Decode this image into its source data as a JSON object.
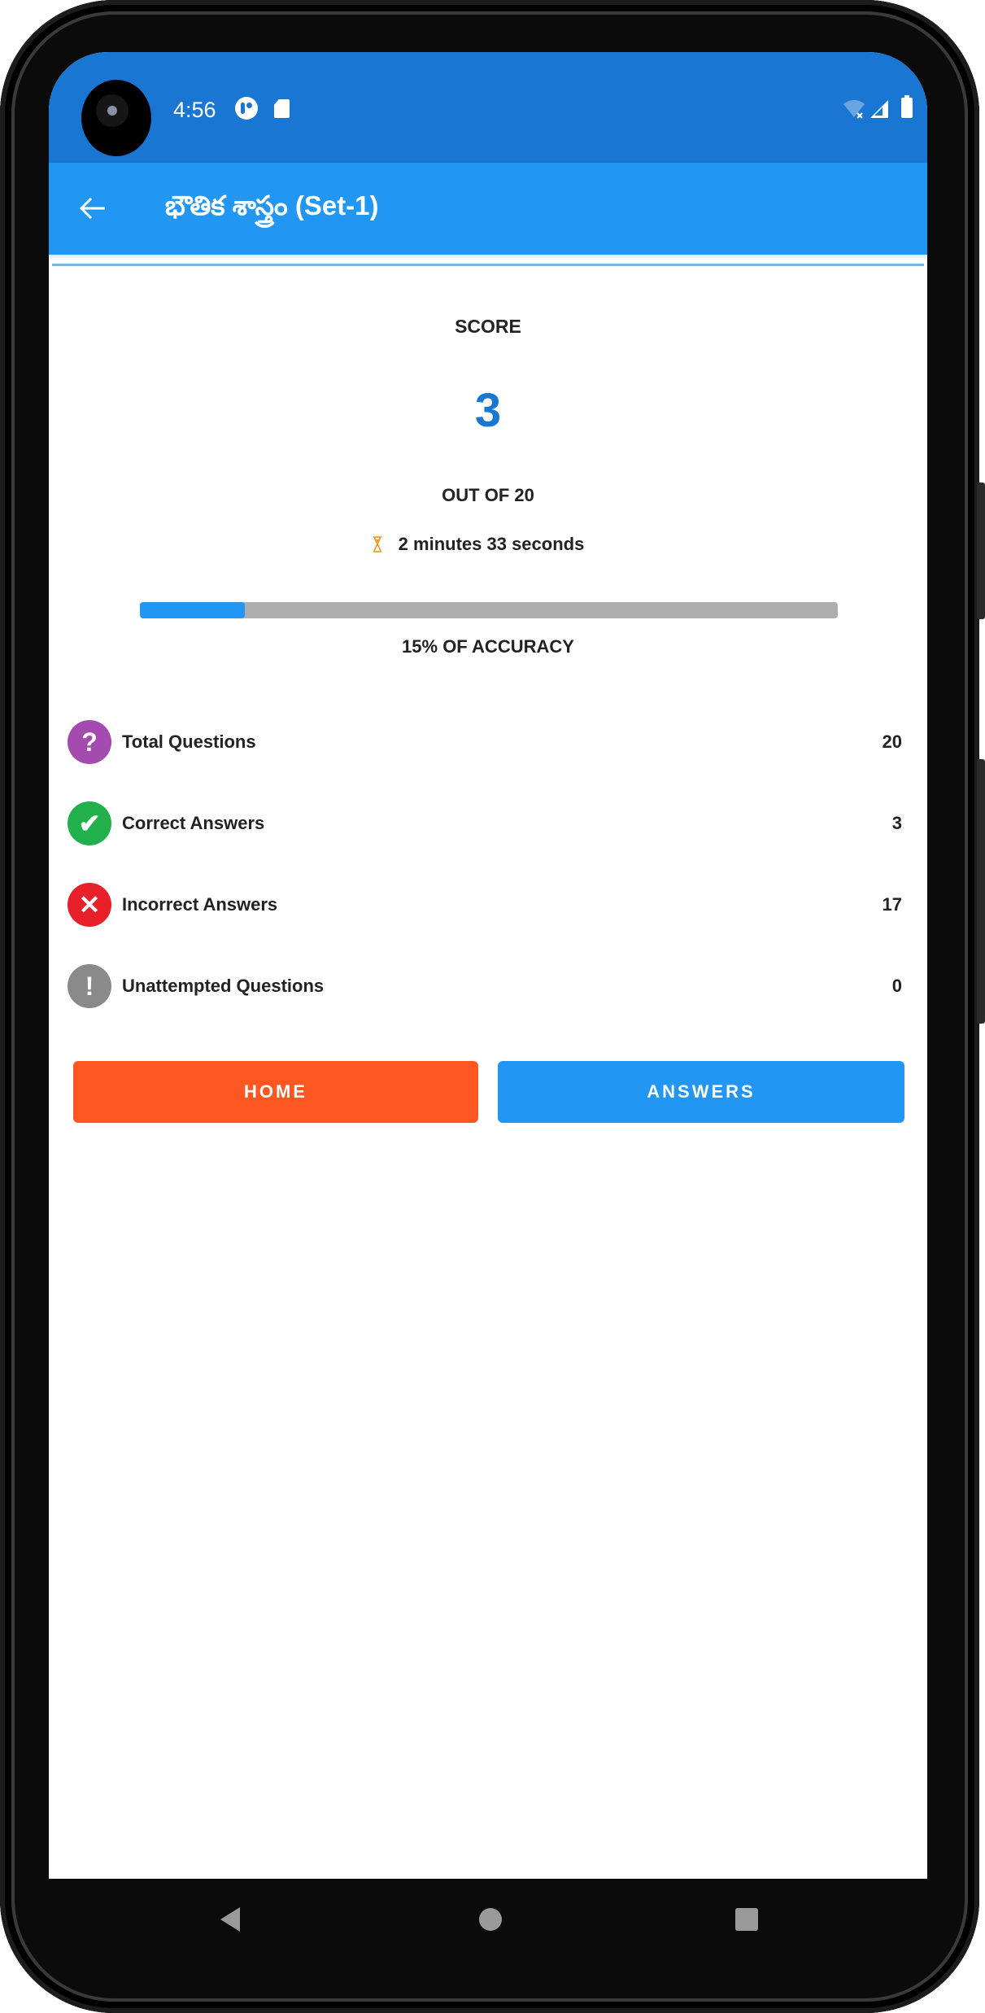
{
  "status_bar": {
    "time": "4:56",
    "icons": [
      "camera-cutout",
      "pocket-casts-icon",
      "sd-card-icon",
      "wifi-off-icon",
      "signal-icon",
      "battery-icon"
    ]
  },
  "app_bar": {
    "back_icon": "arrow-left-icon",
    "title": "భౌతిక శాస్త్రం (Set-1)"
  },
  "result": {
    "score_label": "SCORE",
    "score_value": "3",
    "out_of": "OUT OF 20",
    "elapsed": "2 minutes 33 seconds",
    "accuracy_percent": 15,
    "accuracy_label": "15% OF ACCURACY"
  },
  "stats": [
    {
      "label": "Total Questions",
      "value": "20",
      "icon": "question-icon",
      "glyph": "?",
      "color": "#A44BB0"
    },
    {
      "label": "Correct Answers",
      "value": "3",
      "icon": "check-icon",
      "glyph": "✔",
      "color": "#21B04B"
    },
    {
      "label": "Incorrect Answers",
      "value": "17",
      "icon": "close-icon",
      "glyph": "✕",
      "color": "#E8202A"
    },
    {
      "label": "Unattempted Questions",
      "value": "0",
      "icon": "exclamation-icon",
      "glyph": "!",
      "color": "#8A8A8A"
    }
  ],
  "buttons": {
    "home": "HOME",
    "answers": "ANSWERS",
    "home_color": "#FF5722",
    "answers_color": "#2196F3"
  },
  "colors": {
    "status_bar": "#1976D2",
    "app_bar": "#2196F3",
    "score": "#1976D2",
    "progress_track": "#AEAEAE",
    "progress_fill": "#2196F3",
    "hourglass": "#F0A020"
  },
  "nav_bar": {
    "icons": [
      "nav-back-icon",
      "nav-home-icon",
      "nav-recents-icon"
    ]
  }
}
